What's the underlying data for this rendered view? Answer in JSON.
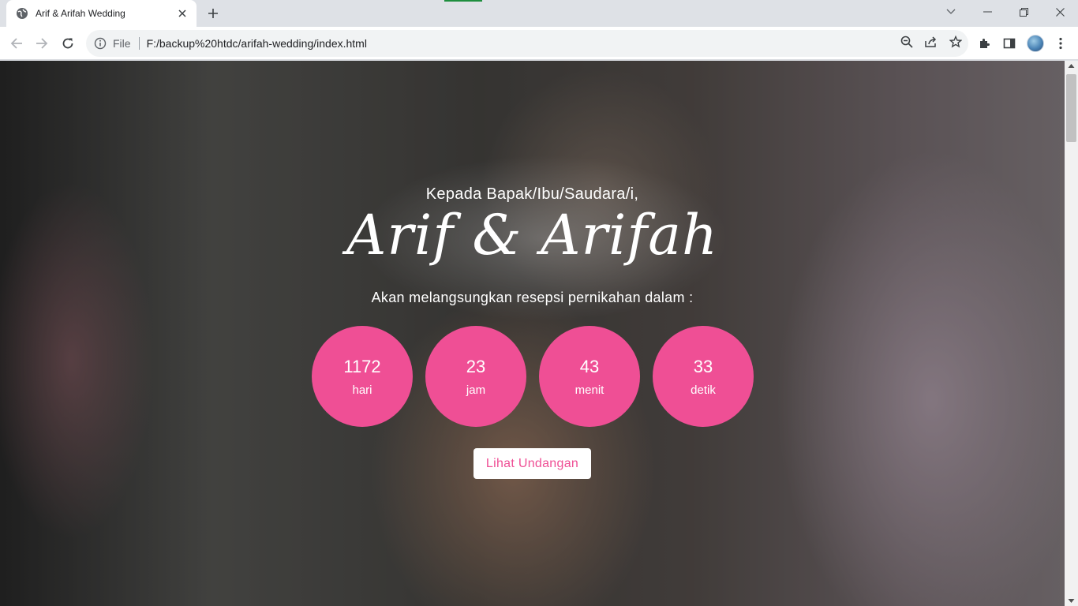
{
  "browser": {
    "tab_title": "Arif & Arifah Wedding",
    "scheme_label": "File",
    "url": "F:/backup%20htdc/arifah-wedding/index.html",
    "icons": [
      "globe-icon",
      "close-icon",
      "plus-icon",
      "chevron-down-icon",
      "minimize-icon",
      "restore-icon",
      "window-close-icon",
      "back-icon",
      "forward-icon",
      "reload-icon",
      "info-icon",
      "zoom-icon",
      "share-icon",
      "star-icon",
      "extensions-icon",
      "side-panel-icon",
      "avatar",
      "more-icon"
    ]
  },
  "page": {
    "greeting": "Kepada Bapak/Ibu/Saudara/i,",
    "couple_names": "Arif & Arifah",
    "subtitle": "Akan melangsungkan resepsi pernikahan dalam :",
    "countdown": [
      {
        "value": "1172",
        "label": "hari"
      },
      {
        "value": "23",
        "label": "jam"
      },
      {
        "value": "43",
        "label": "menit"
      },
      {
        "value": "33",
        "label": "detik"
      }
    ],
    "cta_label": "Lihat Undangan",
    "accent_color": "#ef4f95"
  }
}
